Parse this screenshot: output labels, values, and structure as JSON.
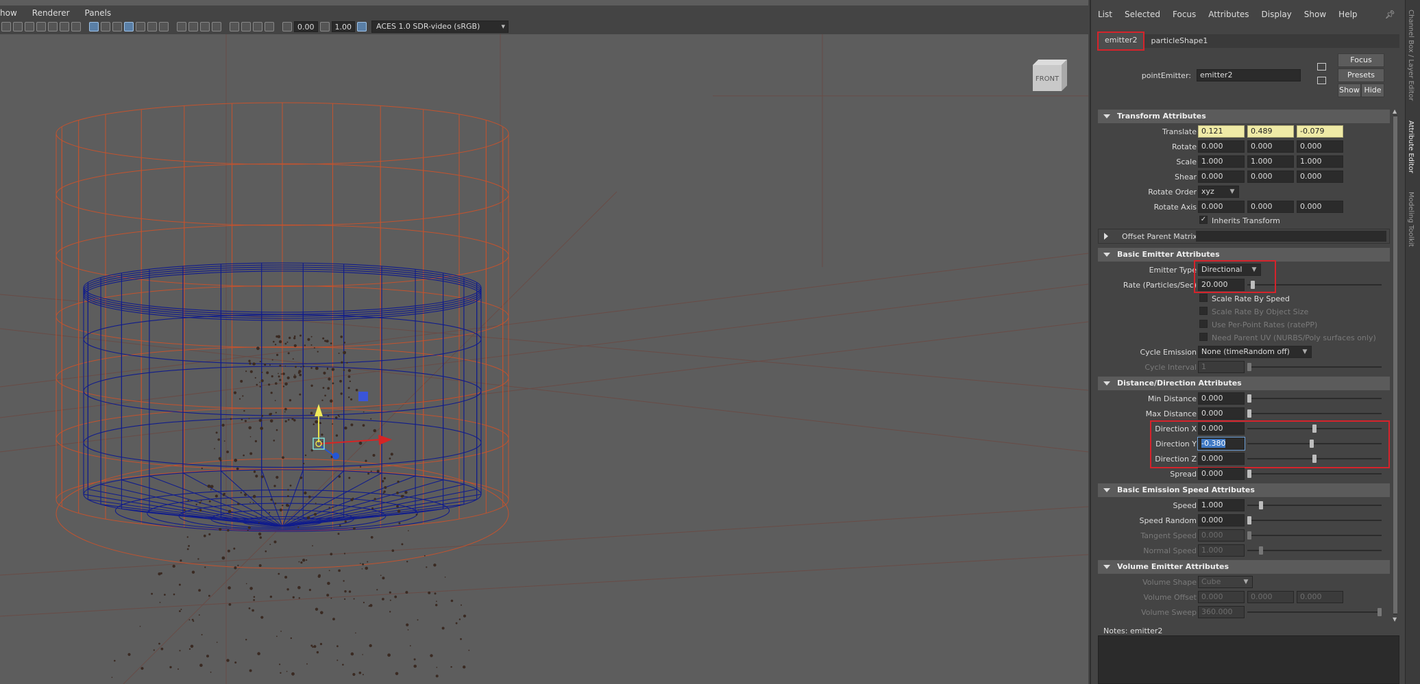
{
  "viewport": {
    "menu": [
      "how",
      "Renderer",
      "Panels"
    ],
    "exposure": "0.00",
    "gamma": "1.00",
    "color_management": "ACES 1.0 SDR-video (sRGB)",
    "view_cube_label": "FRONT"
  },
  "ae": {
    "menu": [
      "List",
      "Selected",
      "Focus",
      "Attributes",
      "Display",
      "Show",
      "Help"
    ],
    "tabs": [
      "emitter2",
      "particleShape1"
    ],
    "node_type_label": "pointEmitter:",
    "node_name": "emitter2",
    "buttons": {
      "focus": "Focus",
      "presets": "Presets",
      "show": "Show",
      "hide": "Hide"
    },
    "transform": {
      "title": "Transform Attributes",
      "translate": {
        "label": "Translate",
        "values": [
          "0.121",
          "0.489",
          "-0.079"
        ]
      },
      "rotate": {
        "label": "Rotate",
        "values": [
          "0.000",
          "0.000",
          "0.000"
        ]
      },
      "scale": {
        "label": "Scale",
        "values": [
          "1.000",
          "1.000",
          "1.000"
        ]
      },
      "shear": {
        "label": "Shear",
        "values": [
          "0.000",
          "0.000",
          "0.000"
        ]
      },
      "rotate_order": {
        "label": "Rotate Order",
        "value": "xyz"
      },
      "rotate_axis": {
        "label": "Rotate Axis",
        "values": [
          "0.000",
          "0.000",
          "0.000"
        ]
      },
      "inherits_transform": "Inherits Transform",
      "offset_parent_matrix": "Offset Parent Matrix"
    },
    "basic_emitter": {
      "title": "Basic Emitter Attributes",
      "emitter_type": {
        "label": "Emitter Type",
        "value": "Directional"
      },
      "rate": {
        "label": "Rate (Particles/Sec)",
        "value": "20.000",
        "slider": 0.04
      },
      "scale_rate_by_speed": "Scale Rate By Speed",
      "scale_rate_by_object_size": "Scale Rate By Object Size",
      "use_per_point_rates": "Use Per-Point Rates (ratePP)",
      "need_parent_uv": "Need Parent UV (NURBS/Poly surfaces only)",
      "cycle_emission": {
        "label": "Cycle Emission",
        "value": "None (timeRandom off)"
      },
      "cycle_interval": {
        "label": "Cycle Interval",
        "value": "1"
      }
    },
    "distance_direction": {
      "title": "Distance/Direction Attributes",
      "min_distance": {
        "label": "Min Distance",
        "value": "0.000",
        "slider": 0.0
      },
      "max_distance": {
        "label": "Max Distance",
        "value": "0.000",
        "slider": 0.0
      },
      "direction_x": {
        "label": "Direction X",
        "value": "0.000",
        "slider": 0.5
      },
      "direction_y": {
        "label": "Direction Y",
        "value": "-0.380",
        "slider": 0.48
      },
      "direction_z": {
        "label": "Direction Z",
        "value": "0.000",
        "slider": 0.5
      },
      "spread": {
        "label": "Spread",
        "value": "0.000",
        "slider": 0.0
      }
    },
    "emission_speed": {
      "title": "Basic Emission Speed Attributes",
      "speed": {
        "label": "Speed",
        "value": "1.000",
        "slider": 0.1
      },
      "speed_random": {
        "label": "Speed Random",
        "value": "0.000",
        "slider": 0.0
      },
      "tangent_speed": {
        "label": "Tangent Speed",
        "value": "0.000",
        "slider": 0.0
      },
      "normal_speed": {
        "label": "Normal Speed",
        "value": "1.000",
        "slider": 0.1
      }
    },
    "volume_emitter": {
      "title": "Volume Emitter Attributes",
      "volume_shape": {
        "label": "Volume Shape",
        "value": "Cube"
      },
      "volume_offset": {
        "label": "Volume Offset",
        "values": [
          "0.000",
          "0.000",
          "0.000"
        ]
      },
      "volume_sweep": {
        "label": "Volume Sweep",
        "value": "360.000",
        "slider": 1.0
      }
    },
    "notes_label": "Notes:  emitter2"
  },
  "side_tabs": [
    "Channel Box / Layer Editor",
    "Attribute Editor",
    "Modeling Toolkit"
  ],
  "colors": {
    "highlight": "#d6232b",
    "keyed": "#efeaa6",
    "wire_blue": "#101c8c",
    "wire_orange": "#c4532e"
  }
}
